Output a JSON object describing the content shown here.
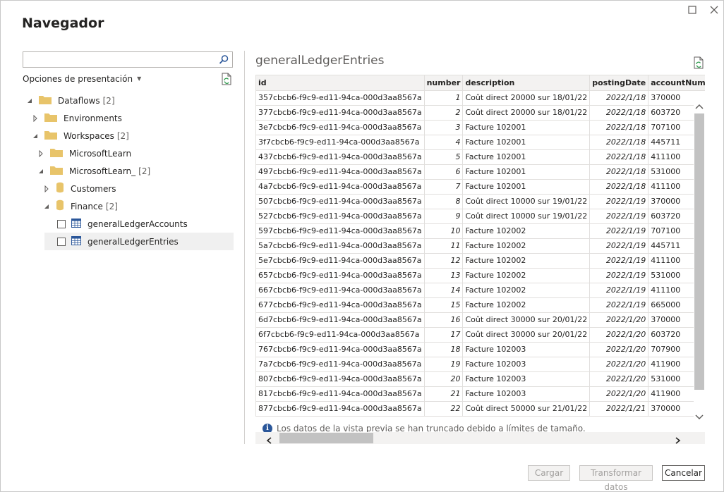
{
  "window": {
    "title": "Navegador"
  },
  "left": {
    "search_placeholder": "",
    "options_label": "Opciones de presentación",
    "tree": [
      {
        "label": "Dataflows",
        "count": "[2]"
      },
      {
        "label": "Environments",
        "count": ""
      },
      {
        "label": "Workspaces",
        "count": "[2]"
      },
      {
        "label": "MicrosoftLearn",
        "count": ""
      },
      {
        "label": "MicrosoftLearn_",
        "count": "[2]"
      },
      {
        "label": "Customers",
        "count": ""
      },
      {
        "label": "Finance",
        "count": "[2]"
      },
      {
        "label": "generalLedgerAccounts",
        "count": ""
      },
      {
        "label": "generalLedgerEntries",
        "count": ""
      }
    ]
  },
  "preview": {
    "title": "generalLedgerEntries",
    "columns": [
      "id",
      "number",
      "description",
      "postingDate",
      "accountNum"
    ],
    "rows": [
      [
        "357cbcb6-f9c9-ed11-94ca-000d3aa8567a",
        "1",
        "Coût direct 20000 sur 18/01/22",
        "2022/1/18",
        "370000"
      ],
      [
        "377cbcb6-f9c9-ed11-94ca-000d3aa8567a",
        "2",
        "Coût direct 20000 sur 18/01/22",
        "2022/1/18",
        "603720"
      ],
      [
        "3e7cbcb6-f9c9-ed11-94ca-000d3aa8567a",
        "3",
        "Facture 102001",
        "2022/1/18",
        "707100"
      ],
      [
        "3f7cbcb6-f9c9-ed11-94ca-000d3aa8567a",
        "4",
        "Facture 102001",
        "2022/1/18",
        "445711"
      ],
      [
        "437cbcb6-f9c9-ed11-94ca-000d3aa8567a",
        "5",
        "Facture 102001",
        "2022/1/18",
        "411100"
      ],
      [
        "497cbcb6-f9c9-ed11-94ca-000d3aa8567a",
        "6",
        "Facture 102001",
        "2022/1/18",
        "531000"
      ],
      [
        "4a7cbcb6-f9c9-ed11-94ca-000d3aa8567a",
        "7",
        "Facture 102001",
        "2022/1/18",
        "411100"
      ],
      [
        "507cbcb6-f9c9-ed11-94ca-000d3aa8567a",
        "8",
        "Coût direct 10000 sur 19/01/22",
        "2022/1/19",
        "370000"
      ],
      [
        "527cbcb6-f9c9-ed11-94ca-000d3aa8567a",
        "9",
        "Coût direct 10000 sur 19/01/22",
        "2022/1/19",
        "603720"
      ],
      [
        "597cbcb6-f9c9-ed11-94ca-000d3aa8567a",
        "10",
        "Facture 102002",
        "2022/1/19",
        "707100"
      ],
      [
        "5a7cbcb6-f9c9-ed11-94ca-000d3aa8567a",
        "11",
        "Facture 102002",
        "2022/1/19",
        "445711"
      ],
      [
        "5e7cbcb6-f9c9-ed11-94ca-000d3aa8567a",
        "12",
        "Facture 102002",
        "2022/1/19",
        "411100"
      ],
      [
        "657cbcb6-f9c9-ed11-94ca-000d3aa8567a",
        "13",
        "Facture 102002",
        "2022/1/19",
        "531000"
      ],
      [
        "667cbcb6-f9c9-ed11-94ca-000d3aa8567a",
        "14",
        "Facture 102002",
        "2022/1/19",
        "411100"
      ],
      [
        "677cbcb6-f9c9-ed11-94ca-000d3aa8567a",
        "15",
        "Facture 102002",
        "2022/1/19",
        "665000"
      ],
      [
        "6d7cbcb6-f9c9-ed11-94ca-000d3aa8567a",
        "16",
        "Coût direct 30000 sur 20/01/22",
        "2022/1/20",
        "370000"
      ],
      [
        "6f7cbcb6-f9c9-ed11-94ca-000d3aa8567a",
        "17",
        "Coût direct 30000 sur 20/01/22",
        "2022/1/20",
        "603720"
      ],
      [
        "767cbcb6-f9c9-ed11-94ca-000d3aa8567a",
        "18",
        "Facture 102003",
        "2022/1/20",
        "707900"
      ],
      [
        "7a7cbcb6-f9c9-ed11-94ca-000d3aa8567a",
        "19",
        "Facture 102003",
        "2022/1/20",
        "411900"
      ],
      [
        "807cbcb6-f9c9-ed11-94ca-000d3aa8567a",
        "20",
        "Facture 102003",
        "2022/1/20",
        "531000"
      ],
      [
        "817cbcb6-f9c9-ed11-94ca-000d3aa8567a",
        "21",
        "Facture 102003",
        "2022/1/20",
        "411900"
      ],
      [
        "877cbcb6-f9c9-ed11-94ca-000d3aa8567a",
        "22",
        "Coût direct 50000 sur 21/01/22",
        "2022/1/21",
        "370000"
      ]
    ],
    "info_text": "Los datos de la vista previa se han truncado debido a límites de tamaño."
  },
  "buttons": {
    "load": "Cargar",
    "transform": "Transformar datos",
    "cancel": "Cancelar"
  },
  "colors": {
    "folder": "#e8c46a",
    "cylinder": "#e8c46a",
    "table_icon": "#2b579a",
    "scroll_thumb": "#c2c2c2"
  },
  "icons": [
    "search-icon",
    "refresh-icon",
    "folder-icon",
    "database-icon",
    "table-icon",
    "info-icon",
    "close-icon",
    "maximize-icon"
  ]
}
